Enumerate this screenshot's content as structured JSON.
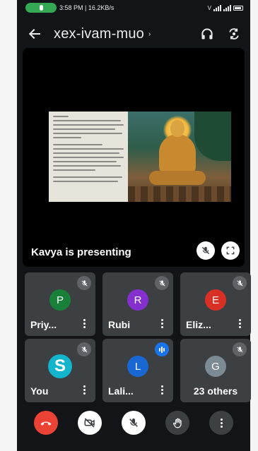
{
  "status_bar": {
    "text": "3:58 PM | 16.2KB/s",
    "network_label": "V"
  },
  "header": {
    "meeting_code": "xex-ivam-muo",
    "chevron": "›"
  },
  "presentation": {
    "label": "Kavya is presenting"
  },
  "participants": [
    {
      "name": "Priy...",
      "initial": "P",
      "avatar_color": "#188038",
      "muted": true
    },
    {
      "name": "Rubi",
      "initial": "R",
      "avatar_color": "#8430ce",
      "muted": true
    },
    {
      "name": "Eliz...",
      "initial": "E",
      "avatar_color": "#d93025",
      "muted": true
    },
    {
      "name": "You",
      "initial": "S",
      "avatar_color": "#12b5cb",
      "muted": true
    },
    {
      "name": "Lali...",
      "initial": "L",
      "avatar_color": "#1967d2",
      "muted": false,
      "speaking": true
    },
    {
      "name": "23 others",
      "initial": "G",
      "avatar_color": "#7b8a93",
      "muted": true
    }
  ],
  "colors": {
    "background": "#121417",
    "tile": "#3c4043",
    "end_call": "#ea4335",
    "speaking": "#1a73e8"
  },
  "icons": {
    "back": "back-arrow-icon",
    "audio_output": "headphones-icon",
    "switch_camera": "switch-camera-icon",
    "pin_muted": "mic-off-icon",
    "fullscreen": "fullscreen-icon",
    "end_call": "end-call-icon",
    "camera": "camera-off-icon",
    "mic": "mic-off-icon",
    "raise_hand": "raise-hand-icon",
    "more": "more-vert-icon"
  }
}
